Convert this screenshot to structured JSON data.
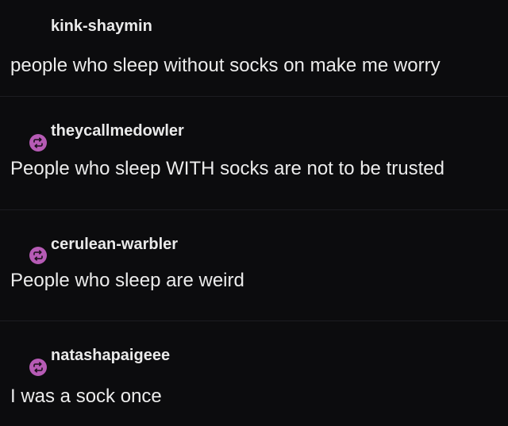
{
  "posts": [
    {
      "username": "kink-shaymin",
      "text": "people who sleep without socks on make me worry",
      "icon": "none"
    },
    {
      "username": "theycallmedowler",
      "text": "People who sleep WITH socks are not to be trusted",
      "icon": "reblog-icon"
    },
    {
      "username": "cerulean-warbler",
      "text": "People who sleep are weird",
      "icon": "reblog-icon"
    },
    {
      "username": "natashapaigeee",
      "text": "I was a sock once",
      "icon": "reblog-icon"
    }
  ],
  "colors": {
    "background": "#0c0c0e",
    "text": "#ececec",
    "reblog_accent": "#b65bb5"
  }
}
